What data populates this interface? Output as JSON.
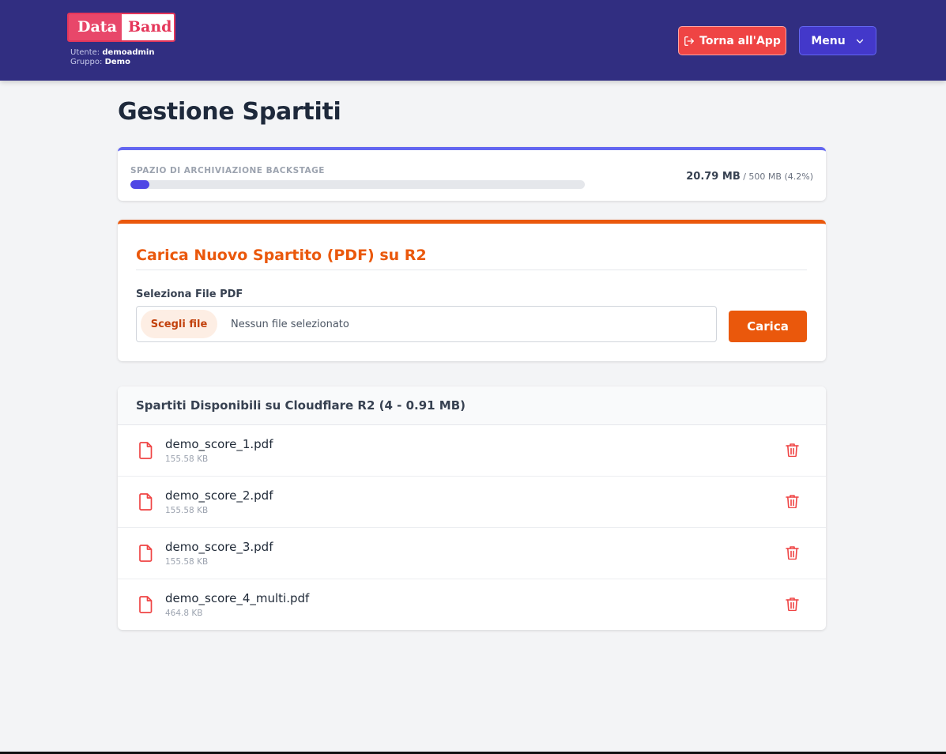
{
  "header": {
    "logo_left": "Data",
    "logo_right": "Band",
    "user_label": "Utente:",
    "user_value": "demoadmin",
    "group_label": "Gruppo:",
    "group_value": "Demo",
    "back_button": "Torna all'App",
    "menu_button": "Menu"
  },
  "page": {
    "title": "Gestione Spartiti"
  },
  "storage": {
    "label": "SPAZIO DI ARCHIVIAZIONE BACKSTAGE",
    "used": "20.79 MB",
    "total": "/ 500 MB (4.2%)",
    "used_fraction": 0.042
  },
  "upload": {
    "title": "Carica Nuovo Spartito (PDF) su R2",
    "field_label": "Seleziona File PDF",
    "choose_button": "Scegli file",
    "no_file_text": "Nessun file selezionato",
    "upload_button": "Carica"
  },
  "list": {
    "title": "Spartiti Disponibili su Cloudflare R2 (4 - 0.91 MB)",
    "items": [
      {
        "name": "demo_score_1.pdf",
        "size": "155.58 KB"
      },
      {
        "name": "demo_score_2.pdf",
        "size": "155.58 KB"
      },
      {
        "name": "demo_score_3.pdf",
        "size": "155.58 KB"
      },
      {
        "name": "demo_score_4_multi.pdf",
        "size": "464.8 KB"
      }
    ]
  },
  "colors": {
    "header_bg": "#312e81",
    "accent_orange": "#ea580c",
    "accent_indigo": "#6366f1",
    "danger_red": "#ef4444"
  },
  "icons": [
    "sign-out-icon",
    "chevron-down-icon",
    "file-pdf-icon",
    "trash-icon"
  ]
}
